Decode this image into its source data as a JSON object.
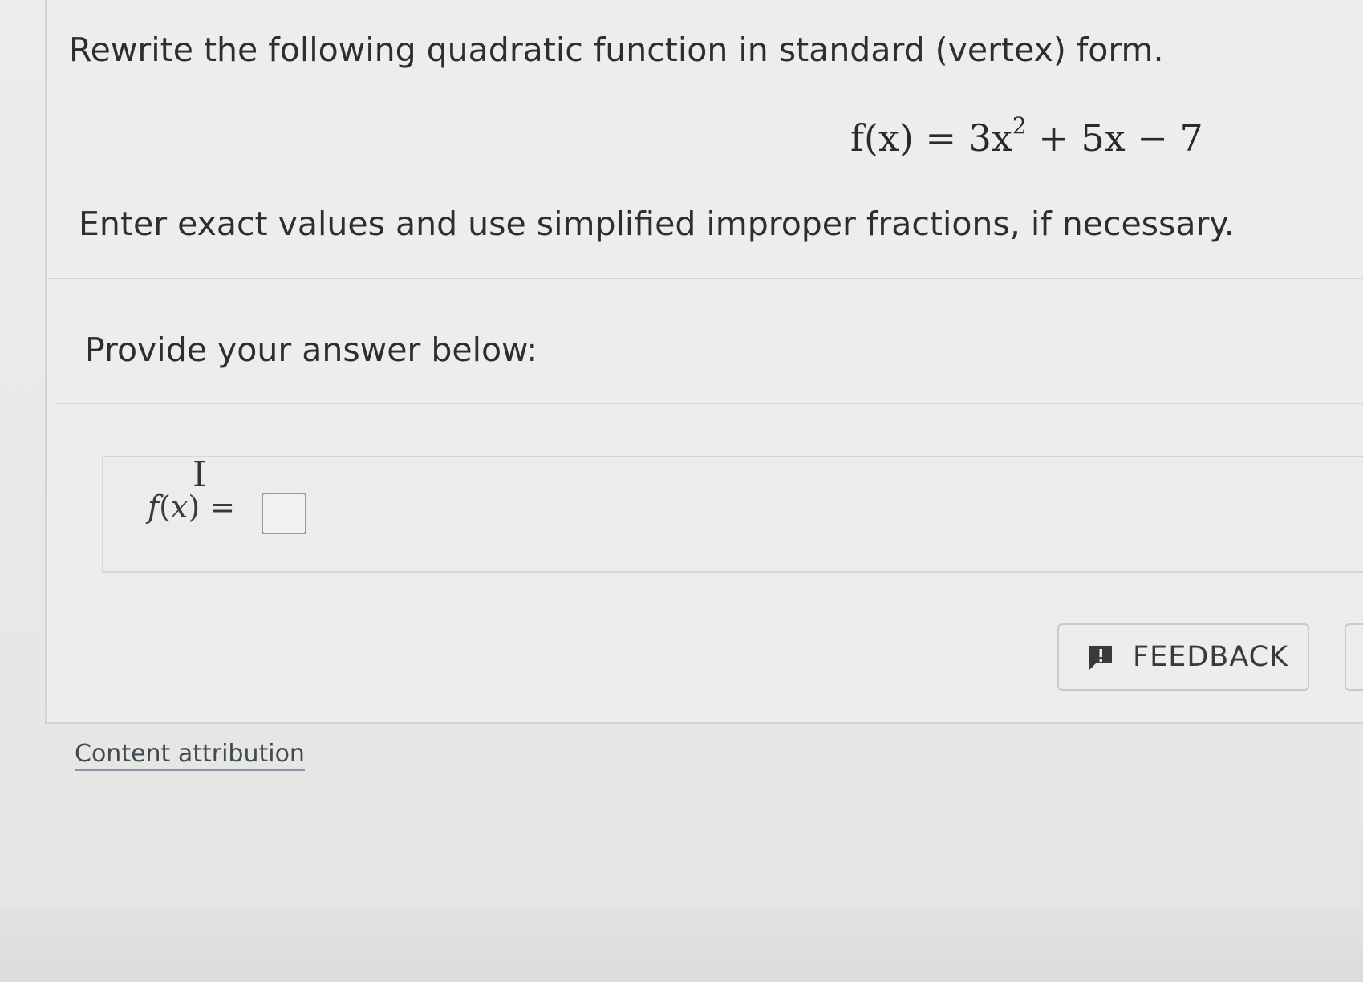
{
  "question": {
    "prompt": "Rewrite the following quadratic function in standard (vertex) form.",
    "equation_lhs": "f(x) = 3x",
    "equation_exp": "2",
    "equation_rhs": " + 5x − 7",
    "instruction": "Enter exact values and use simplified improper fractions, if necessary."
  },
  "answer": {
    "heading": "Provide your answer below:",
    "label_func": "f",
    "label_open": "(",
    "label_var": "x",
    "label_close": ") =",
    "input_value": ""
  },
  "actions": {
    "feedback_label": "FEEDBACK"
  },
  "footer": {
    "attribution_link": "Content attribution"
  },
  "icons": {
    "feedback": "feedback-alert-icon",
    "cursor": "text-cursor-icon"
  },
  "colors": {
    "background": "#ededeb",
    "text": "#2e2e2e",
    "link": "#3f4a55"
  }
}
